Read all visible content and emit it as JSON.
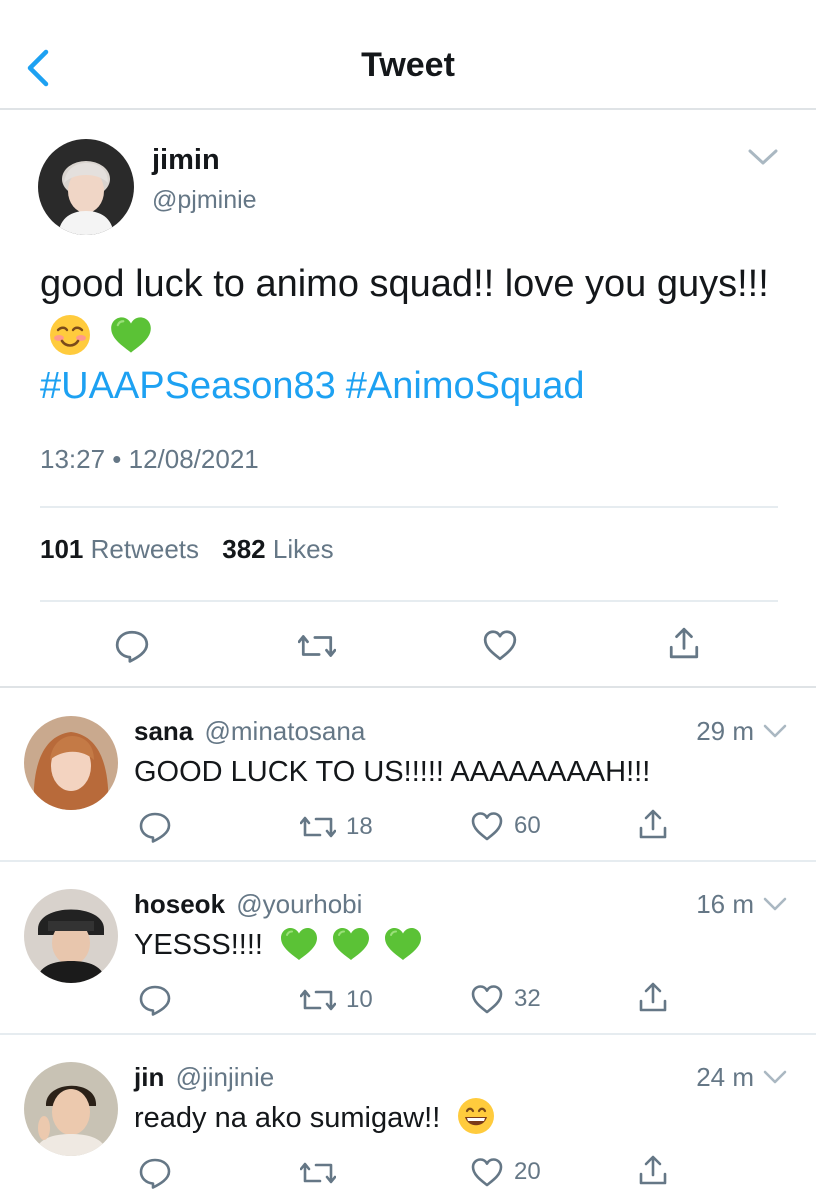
{
  "header": {
    "title": "Tweet"
  },
  "tweet": {
    "name": "jimin",
    "handle": "@pjminie",
    "text": "good luck to animo squad!! love you guys!!!",
    "hashtags": [
      "#UAAPSeason83",
      "#AnimoSquad"
    ],
    "timestamp": "13:27 • 12/08/2021",
    "retweets": "101",
    "retweets_label": "Retweets",
    "likes": "382",
    "likes_label": "Likes"
  },
  "replies": [
    {
      "name": "sana",
      "handle": "@minatosana",
      "time": "29 m",
      "text": "GOOD LUCK TO US!!!!! AAAAAAAAH!!!",
      "retweets": "18",
      "likes": "60"
    },
    {
      "name": "hoseok",
      "handle": "@yourhobi",
      "time": "16 m",
      "text": "YESSS!!!!",
      "retweets": "10",
      "likes": "32"
    },
    {
      "name": "jin",
      "handle": "@jinjinie",
      "time": "24 m",
      "text": "ready na ako sumigaw!!",
      "retweets": "",
      "likes": "20"
    }
  ],
  "colors": {
    "accent": "#1da1f2",
    "text": "#14171a",
    "secondary": "#657786",
    "icon": "#657786",
    "heart_emoji": "#5bc236"
  },
  "icons": [
    "back-chevron",
    "chevron-down",
    "reply",
    "retweet",
    "like",
    "share",
    "smiling-face-emoji",
    "green-heart-emoji",
    "grinning-face-emoji"
  ]
}
